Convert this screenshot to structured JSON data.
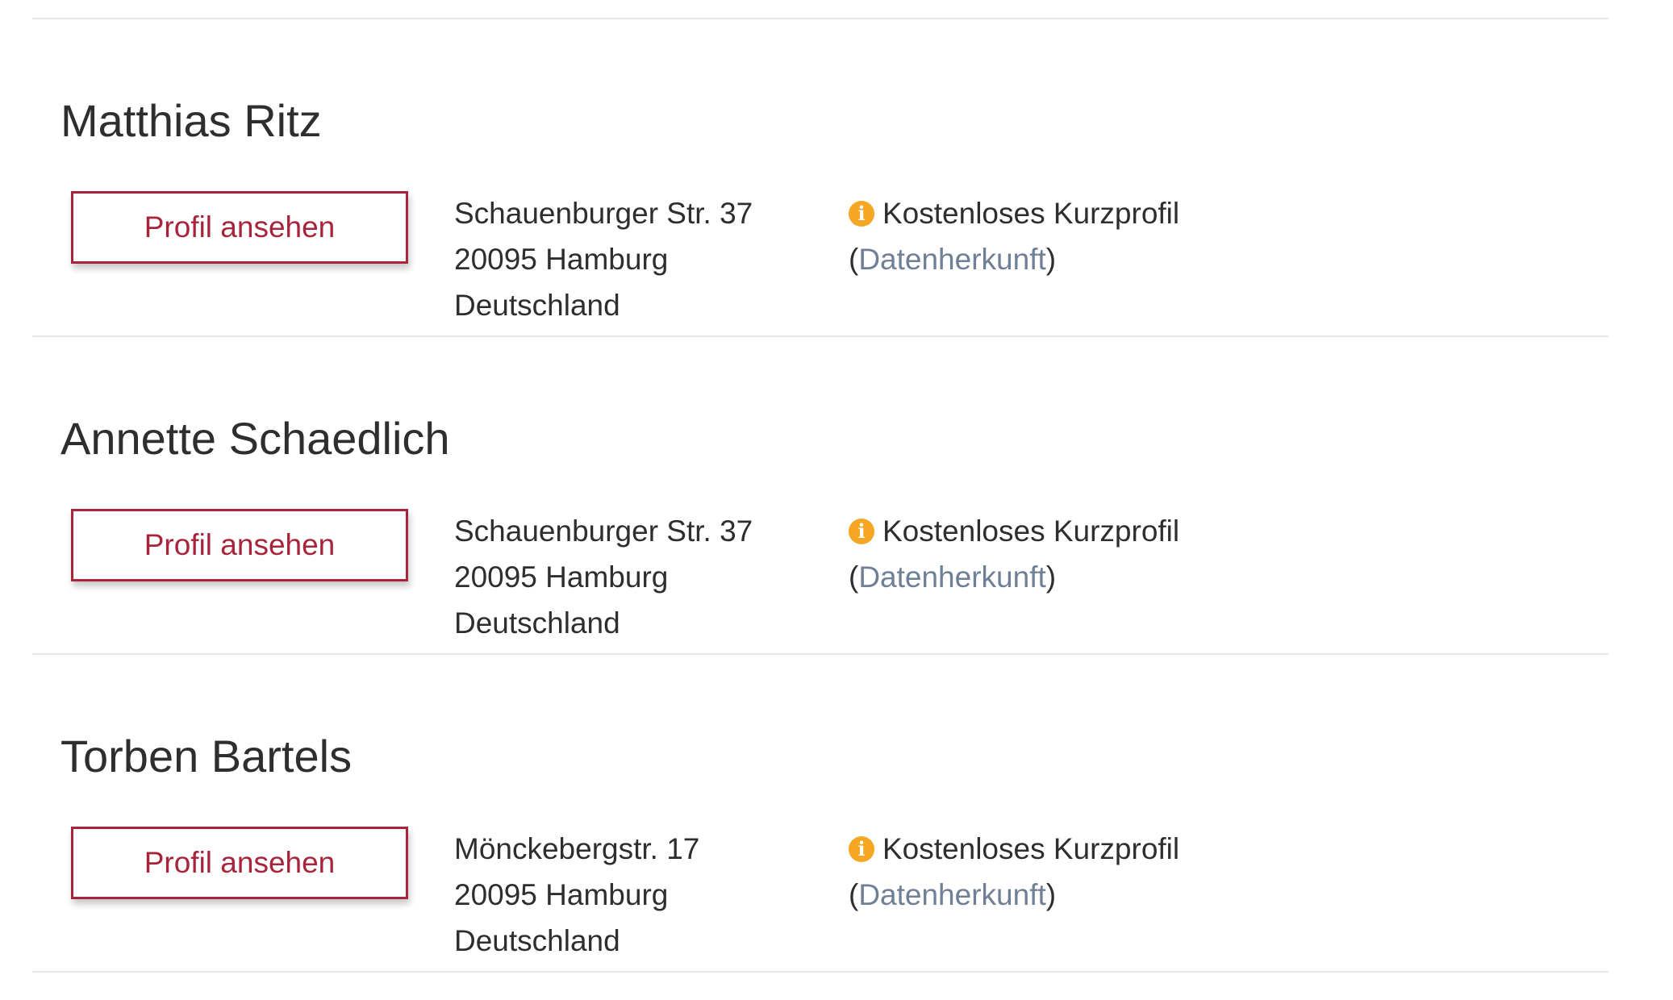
{
  "entries": [
    {
      "name": "Matthias Ritz",
      "button_label": "Profil ansehen",
      "address": [
        "Schauenburger Str. 37",
        "20095 Hamburg",
        "Deutschland"
      ],
      "profile_type": "Kostenloses Kurzprofil",
      "source_link": "Datenherkunft"
    },
    {
      "name": "Annette Schaedlich",
      "button_label": "Profil ansehen",
      "address": [
        "Schauenburger Str. 37",
        "20095 Hamburg",
        "Deutschland"
      ],
      "profile_type": "Kostenloses Kurzprofil",
      "source_link": "Datenherkunft"
    },
    {
      "name": "Torben Bartels",
      "button_label": "Profil ansehen",
      "address": [
        "Mönckebergstr. 17",
        "20095 Hamburg",
        "Deutschland"
      ],
      "profile_type": "Kostenloses Kurzprofil",
      "source_link": "Datenherkunft"
    }
  ],
  "info_icon": {
    "name": "info-icon",
    "glyph": "i",
    "color": "#f5a623"
  },
  "colors": {
    "accent": "#a7243b",
    "link": "#6f7f96",
    "divider": "#e7e7e7"
  }
}
